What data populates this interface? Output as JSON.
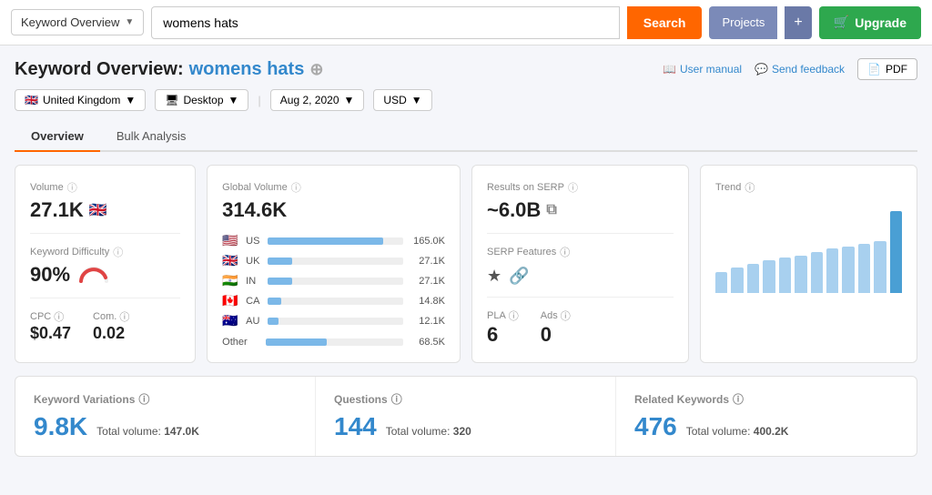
{
  "topnav": {
    "dropdown_label": "Keyword Overview",
    "search_value": "womens hats",
    "search_placeholder": "womens hats",
    "search_btn": "Search",
    "projects_btn": "Projects",
    "upgrade_btn": "Upgrade"
  },
  "page_header": {
    "title_static": "Keyword Overview:",
    "title_kw": "womens hats",
    "user_manual": "User manual",
    "send_feedback": "Send feedback",
    "pdf": "PDF"
  },
  "filters": {
    "region": "United Kingdom",
    "device": "Desktop",
    "date": "Aug 2, 2020",
    "currency": "USD"
  },
  "tabs": [
    {
      "label": "Overview",
      "active": true
    },
    {
      "label": "Bulk Analysis",
      "active": false
    }
  ],
  "volume_card": {
    "label": "Volume",
    "value": "27.1K",
    "flag": "🇬🇧",
    "kd_label": "Keyword Difficulty",
    "kd_value": "90%",
    "cpc_label": "CPC",
    "cpc_value": "$0.47",
    "com_label": "Com.",
    "com_value": "0.02"
  },
  "global_volume_card": {
    "label": "Global Volume",
    "value": "314.6K",
    "countries": [
      {
        "flag": "🇺🇸",
        "code": "US",
        "value": "165.0K",
        "pct": 85
      },
      {
        "flag": "🇬🇧",
        "code": "UK",
        "value": "27.1K",
        "pct": 18
      },
      {
        "flag": "🇮🇳",
        "code": "IN",
        "value": "27.1K",
        "pct": 18
      },
      {
        "flag": "🇨🇦",
        "code": "CA",
        "value": "14.8K",
        "pct": 10
      },
      {
        "flag": "🇦🇺",
        "code": "AU",
        "value": "12.1K",
        "pct": 8
      }
    ],
    "other_label": "Other",
    "other_value": "68.5K",
    "other_pct": 44
  },
  "serp_card": {
    "label": "Results on SERP",
    "value": "~6.0B",
    "serp_features_label": "SERP Features",
    "pla_label": "PLA",
    "pla_value": "6",
    "ads_label": "Ads",
    "ads_value": "0"
  },
  "trend_card": {
    "label": "Trend",
    "bars": [
      18,
      22,
      25,
      28,
      30,
      32,
      35,
      38,
      40,
      42,
      44,
      70
    ]
  },
  "bottom_row": {
    "kw_variations": {
      "label": "Keyword Variations",
      "number": "9.8K",
      "sub_label": "Total volume:",
      "sub_value": "147.0K"
    },
    "questions": {
      "label": "Questions",
      "number": "144",
      "sub_label": "Total volume:",
      "sub_value": "320"
    },
    "related_keywords": {
      "label": "Related Keywords",
      "number": "476",
      "sub_label": "Total volume:",
      "sub_value": "400.2K"
    }
  }
}
